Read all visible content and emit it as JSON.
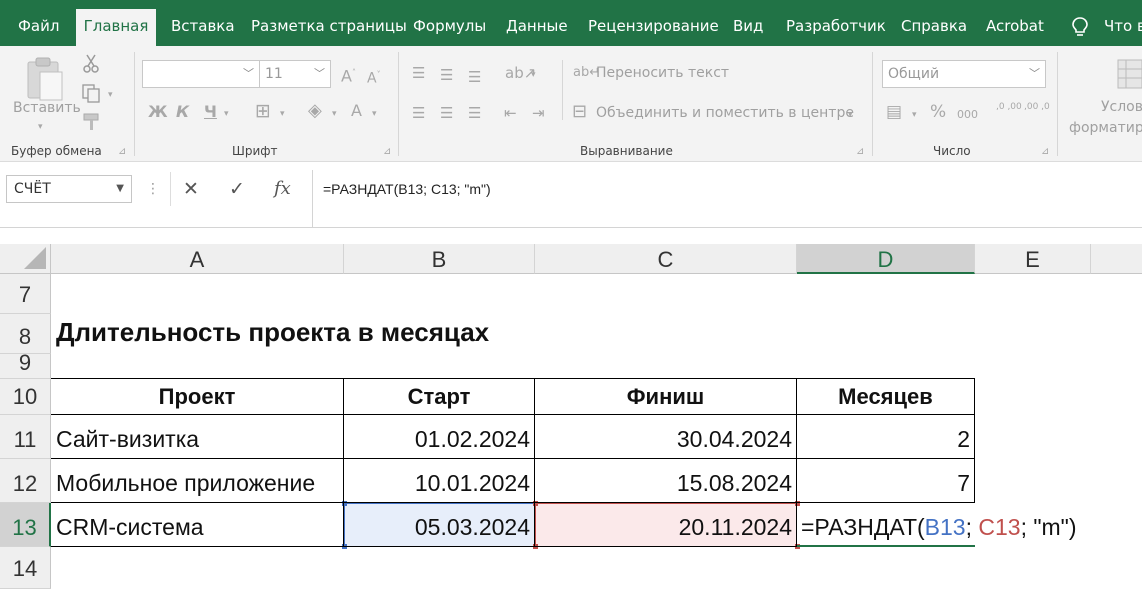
{
  "menu": {
    "tabs": [
      "Файл",
      "Главная",
      "Вставка",
      "Разметка страницы",
      "Формулы",
      "Данные",
      "Рецензирование",
      "Вид",
      "Разработчик",
      "Справка",
      "Acrobat"
    ],
    "active": "Главная",
    "tell_me": "Что в"
  },
  "ribbon": {
    "clipboard": {
      "paste_label": "Вставить",
      "group_label": "Буфер обмена"
    },
    "font": {
      "font_name": "",
      "font_size": "11",
      "bold": "Ж",
      "italic": "К",
      "underline": "Ч",
      "grow": "A",
      "shrink": "A",
      "color": "A",
      "group_label": "Шрифт"
    },
    "alignment": {
      "wrap_label": "Переносить текст",
      "merge_label": "Объединить и поместить в центре",
      "group_label": "Выравнивание"
    },
    "number": {
      "format": "Общий",
      "percent": "%",
      "thousands": "000",
      "inc_decimal": ",0 ,00",
      "dec_decimal": ",00 ,0",
      "group_label": "Число"
    },
    "styles": {
      "cond_label_1": "Услов",
      "cond_label_2": "форматиро"
    }
  },
  "formula_bar": {
    "name_box": "СЧЁТ",
    "cancel": "✕",
    "enter": "✓",
    "fx": "fx",
    "formula": "=РАЗНДАТ(B13; C13; \"m\")"
  },
  "sheet": {
    "columns": [
      "A",
      "B",
      "C",
      "D",
      "E"
    ],
    "selected_column": "D",
    "rows": [
      "7",
      "8",
      "9",
      "10",
      "11",
      "12",
      "13",
      "14"
    ],
    "selected_row": "13",
    "title": "Длительность проекта в месяцах",
    "table": {
      "headers": [
        "Проект",
        "Старт",
        "Финиш",
        "Месяцев"
      ],
      "rows": [
        [
          "Сайт-визитка",
          "01.02.2024",
          "30.04.2024",
          "2"
        ],
        [
          "Мобильное приложение",
          "10.01.2024",
          "15.08.2024",
          "7"
        ],
        [
          "CRM-система",
          "05.03.2024",
          "20.11.2024",
          ""
        ]
      ]
    },
    "edit_formula": {
      "prefix": "=РАЗНДАТ(",
      "ref1": "B13",
      "sep1": "; ",
      "ref2": "C13",
      "rest": "; \"m\")"
    }
  },
  "colors": {
    "accent": "#217346",
    "ref1": "#4472c4",
    "ref1_fill": "#e7eefa",
    "ref2": "#c0504d",
    "ref2_fill": "#fbe9ea"
  }
}
